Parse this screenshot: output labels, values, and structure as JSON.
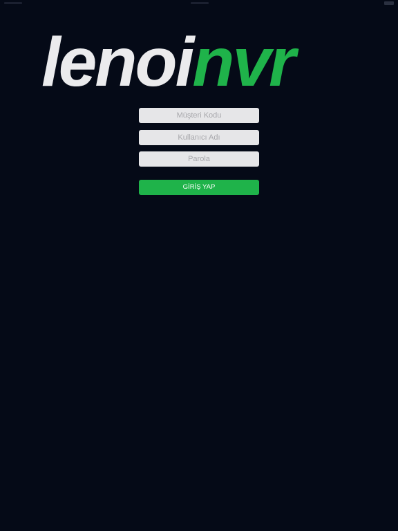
{
  "logo": {
    "part_a": "lenoi",
    "part_b": "nvr"
  },
  "form": {
    "customer_code_placeholder": "Müşteri Kodu",
    "username_placeholder": "Kullanıcı Adı",
    "password_placeholder": "Parola",
    "login_label": "GİRİŞ YAP"
  },
  "colors": {
    "background": "#050a17",
    "brand_green": "#1fb34a",
    "logo_white": "#ebebed",
    "field_bg": "#e6e6e8"
  }
}
